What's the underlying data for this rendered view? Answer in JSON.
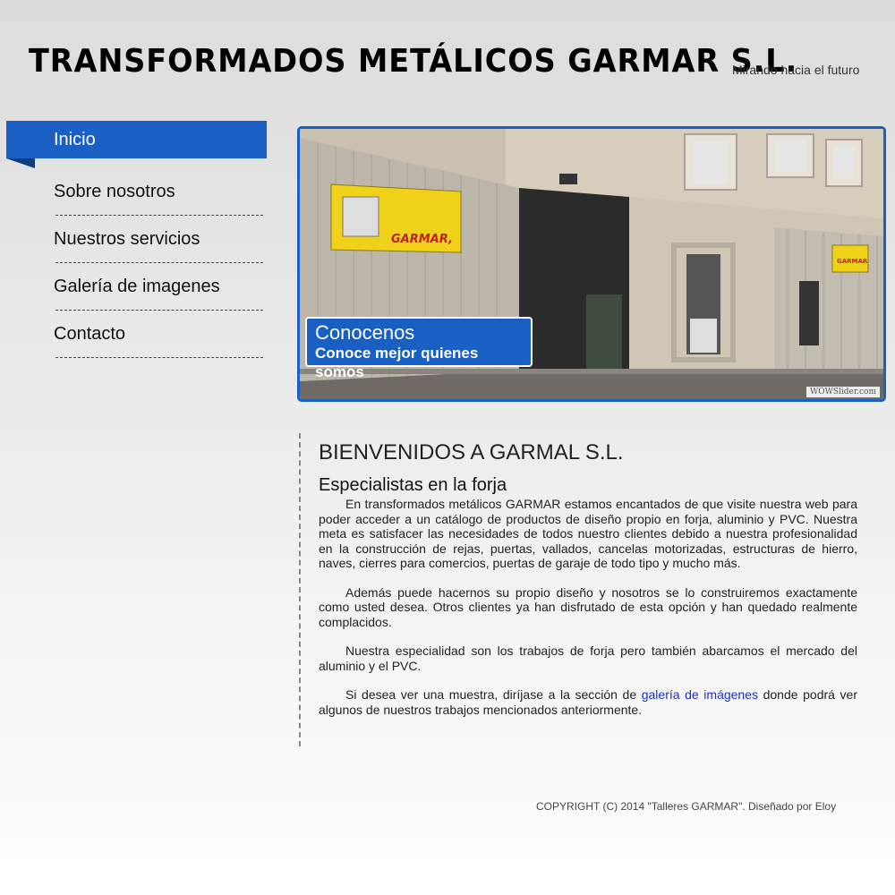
{
  "header": {
    "title": "TRANSFORMADOS METÁLICOS GARMAR S.L.",
    "tagline": "Mirando hacia el futuro"
  },
  "nav": {
    "items": [
      {
        "label": "Inicio",
        "active": true
      },
      {
        "label": "Sobre nosotros",
        "active": false
      },
      {
        "label": "Nuestros servicios",
        "active": false
      },
      {
        "label": "Galería de imagenes",
        "active": false
      },
      {
        "label": "Contacto",
        "active": false
      }
    ]
  },
  "slider": {
    "caption_title": "Conocenos",
    "caption_subtitle": "Conoce mejor quienes somos",
    "watermark": "WOWSlider.com",
    "sign_text": "GARMAR",
    "sign_text_2": "GARMAR,"
  },
  "content": {
    "heading": "BIENVENIDOS A GARMAL S.L.",
    "subheading": "Especialistas en la forja",
    "p1": "En transformados metálicos GARMAR estamos encantados de que visite nuestra web para poder acceder a un catálogo de productos de diseño propio en forja, aluminio y PVC. Nuestra meta es satisfacer las necesidades de todos nuestro clientes debido a nuestra profesionalidad en la construcción de rejas, puertas, vallados, cancelas motorizadas, estructuras de hierro, naves, cierres para comercios, puertas de garaje de todo tipo y mucho más.",
    "p2": "Además puede hacernos su propio diseño y nosotros se lo construiremos exactamente como usted desea. Otros clientes ya han disfrutado de esta opción y han quedado realmente complacidos.",
    "p3": "Nuestra especialidad son los trabajos de forja pero también abarcamos el mercado del aluminio y el PVC.",
    "p4_before": "Si desea ver una muestra, diríjase a la sección de ",
    "p4_link": "galería de imágenes",
    "p4_after": " donde podrá ver algunos de nuestros trabajos mencionados anteriormente."
  },
  "footer": {
    "copyright": "COPYRIGHT (C) 2014 \"Talleres GARMAR\". Diseñado por Eloy"
  },
  "colors": {
    "accent": "#1a5fc4",
    "link": "#1a2fc8"
  }
}
